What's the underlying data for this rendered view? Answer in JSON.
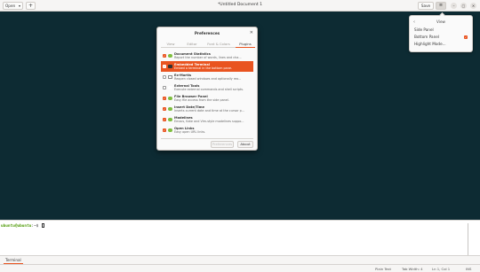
{
  "header": {
    "open_label": "Open",
    "new_tab_label": "+",
    "title": "*Untitled Document 1",
    "save_label": "Save",
    "menu_label": "≡",
    "window_controls": [
      "–",
      "▢",
      "✕"
    ]
  },
  "view_popover": {
    "back_label": "‹",
    "title": "View",
    "items": [
      {
        "label": "Side Panel",
        "checked": false
      },
      {
        "label": "Bottom Panel",
        "checked": true
      },
      {
        "label": "Highlight Mode...",
        "checked": false
      }
    ]
  },
  "preferences": {
    "title": "Preferences",
    "close_label": "✕",
    "tabs": [
      "View",
      "Editor",
      "Font & Colors",
      "Plugins"
    ],
    "active_tab": "Plugins",
    "plugins": [
      {
        "name": "Document Statistics",
        "desc": "Report the number of words, lines and cha...",
        "checked": true,
        "selected": false
      },
      {
        "name": "Embedded Terminal",
        "desc": "Embed a terminal in the bottom pane.",
        "checked": true,
        "selected": true
      },
      {
        "name": "Ex-Mortis",
        "desc": "Reopen closed windows and optionally reo...",
        "checked": false,
        "selected": false
      },
      {
        "name": "External Tools",
        "desc": "Execute external commands and shell scripts.",
        "checked": false,
        "selected": false
      },
      {
        "name": "File Browser Panel",
        "desc": "Easy file access from the side panel.",
        "checked": true,
        "selected": false
      },
      {
        "name": "Insert Date/Time",
        "desc": "Inserts current date and time at the cursor p...",
        "checked": true,
        "selected": false
      },
      {
        "name": "Modelines",
        "desc": "Emacs, Kate and Vim-style modelines suppo...",
        "checked": true,
        "selected": false
      },
      {
        "name": "Open Links",
        "desc": "Easy open URL links.",
        "checked": true,
        "selected": false
      }
    ],
    "preferences_button": "Preferences",
    "about_button": "About"
  },
  "terminal": {
    "user_host": "ubuntu@ubuntu",
    "path": ":~$",
    "tab_label": "Terminal"
  },
  "status_bar": {
    "language": "Plain Text",
    "tab_width": "Tab Width: 4",
    "position": "Ln 1, Col 1",
    "insert_mode": "INS"
  },
  "colors": {
    "accent": "#e95420",
    "editor_bg": "#0d2b33",
    "plugin_icon": "#7fbf3f"
  }
}
